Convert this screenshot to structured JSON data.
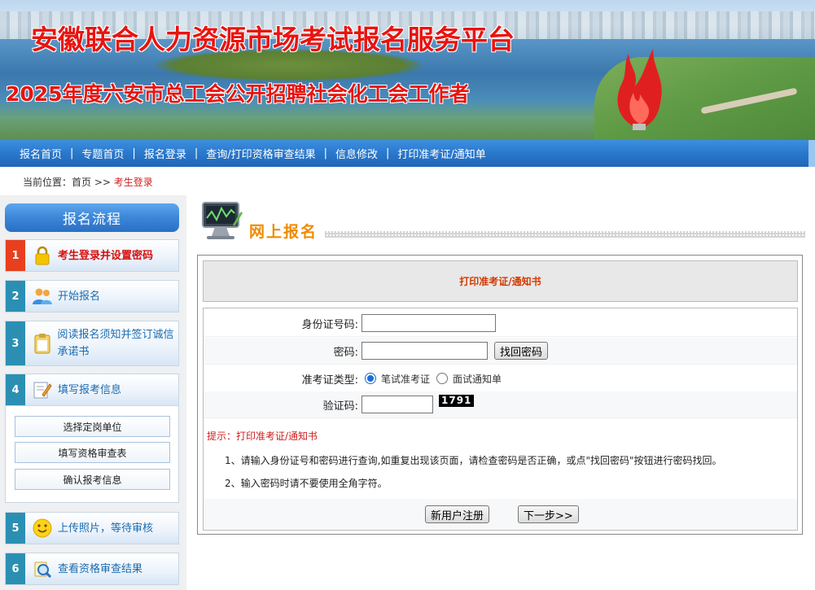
{
  "banner": {
    "title": "安徽联合人力资源市场考试报名服务平台",
    "subtitle": "2025年度六安市总工会公开招聘社会化工会工作者"
  },
  "nav": {
    "items": [
      "报名首页",
      "专题首页",
      "报名登录",
      "查询/打印资格审查结果",
      "信息修改",
      "打印准考证/通知单"
    ]
  },
  "breadcrumb": {
    "prefix": "当前位置：",
    "home": "首页",
    "sep": ">>",
    "current": "考生登录"
  },
  "sidebar": {
    "title": "报名流程",
    "steps": [
      {
        "num": "1",
        "label": "考生登录并设置密码",
        "icon": "lock-icon"
      },
      {
        "num": "2",
        "label": "开始报名",
        "icon": "users-icon"
      },
      {
        "num": "3",
        "label": "阅读报名须知并签订诚信承诺书",
        "icon": "clipboard-icon"
      },
      {
        "num": "4",
        "label": "填写报考信息",
        "icon": "edit-icon"
      },
      {
        "num": "5",
        "label": "上传照片，等待审核",
        "icon": "smiley-icon"
      },
      {
        "num": "6",
        "label": "查看资格审查结果",
        "icon": "search-doc-icon"
      }
    ],
    "sub_buttons": [
      "选择定岗单位",
      "填写资格审查表",
      "确认报考信息"
    ]
  },
  "main": {
    "section_title": "网上报名",
    "panel_title": "打印准考证/通知书",
    "form": {
      "id_label": "身份证号码:",
      "id_value": "",
      "password_label": "密码:",
      "password_value": "",
      "find_password": "找回密码",
      "type_label": "准考证类型:",
      "type_options": [
        "笔试准考证",
        "面试通知单"
      ],
      "type_selected": "笔试准考证",
      "captcha_label": "验证码:",
      "captcha_value": "",
      "captcha_code": "1791"
    },
    "hint_label": "提示：打印准考证/通知书",
    "notes": [
      "1、请输入身份证号和密码进行查询,如重复出现该页面，请检查密码是否正确，或点\"找回密码\"按钮进行密码找回。",
      "2、输入密码时请不要使用全角字符。"
    ],
    "register_button": "新用户注册",
    "next_button": "下一步>>"
  },
  "colors": {
    "nav_blue": "#2a78cc",
    "title_red": "#e8140f",
    "section_orange": "#f08a00",
    "active_red": "#d41010",
    "step_teal": "#2b8fb3"
  }
}
